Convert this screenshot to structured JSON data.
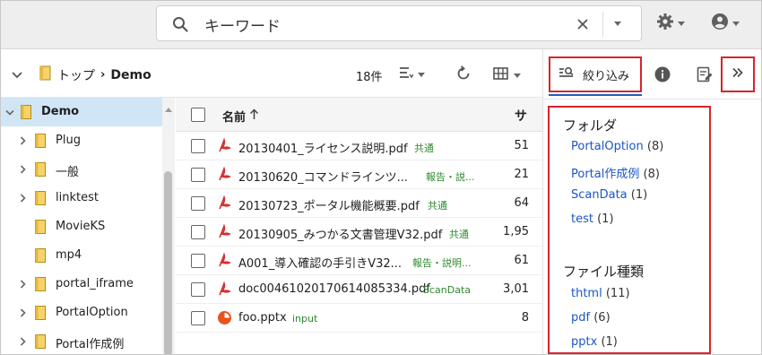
{
  "search": {
    "value": "キーワード",
    "icons": {
      "search": "search-icon",
      "clear": "close-icon",
      "dropdown": "chevron-down-icon"
    }
  },
  "header": {
    "settings_icon": "gear-icon",
    "account_icon": "account-circle-icon"
  },
  "breadcrumb": {
    "root": "トップ",
    "current": "Demo"
  },
  "toolbar": {
    "count": "18件"
  },
  "tree": {
    "items": [
      {
        "label": "Demo",
        "selected": true,
        "expanded": true
      },
      {
        "label": "Plug",
        "has_children": true
      },
      {
        "label": "一般",
        "has_children": true
      },
      {
        "label": "linktest",
        "has_children": true
      },
      {
        "label": "MovieKS",
        "has_children": false
      },
      {
        "label": "mp4",
        "has_children": false
      },
      {
        "label": "portal_iframe",
        "has_children": true
      },
      {
        "label": "PortalOption",
        "has_children": true
      },
      {
        "label": "Portal作成例",
        "has_children": true
      }
    ]
  },
  "filelist": {
    "header": {
      "name": "名前",
      "size": "サ"
    },
    "rows": [
      {
        "name": "20130401_ライセンス説明.pdf",
        "tag": "共通",
        "size": "51",
        "type": "pdf"
      },
      {
        "name": "20130620_コマンドラインツ...",
        "tag": "報告・説...",
        "size": "21",
        "type": "pdf"
      },
      {
        "name": "20130723_ポータル機能概要.pdf",
        "tag": "共通",
        "size": "64",
        "type": "pdf"
      },
      {
        "name": "20130905_みつかる文書管理V32.pdf",
        "tag": "共通",
        "size": "1,95",
        "type": "pdf"
      },
      {
        "name": "A001_導入確認の手引きV32...",
        "tag": "報告・説明...",
        "size": "61",
        "type": "pdf"
      },
      {
        "name": "doc00461020170614085334.pdf",
        "tag": "ScanData",
        "size": "3,01",
        "type": "pdf"
      },
      {
        "name": "foo.pptx",
        "tag": "input",
        "size": "8",
        "type": "pptx"
      }
    ]
  },
  "panel": {
    "filter_tab_label": "絞り込み",
    "facets": [
      {
        "title": "フォルダ",
        "items": [
          {
            "label": "PortalOption",
            "count": "(8)"
          },
          {
            "label": "Portal作成例",
            "count": "(8)"
          },
          {
            "label": "ScanData",
            "count": "(1)"
          },
          {
            "label": "test",
            "count": "(1)"
          }
        ]
      },
      {
        "title": "ファイル種類",
        "items": [
          {
            "label": "thtml",
            "count": "(11)"
          },
          {
            "label": "pdf",
            "count": "(6)"
          },
          {
            "label": "pptx",
            "count": "(1)"
          }
        ]
      }
    ]
  },
  "colors": {
    "accent": "#1f5fbf",
    "highlight": "#d6252b",
    "selected_bg": "#d0e6f7",
    "tag": "#2e8b2e",
    "pdf": "#d32f2f",
    "pptx": "#e8541c"
  }
}
